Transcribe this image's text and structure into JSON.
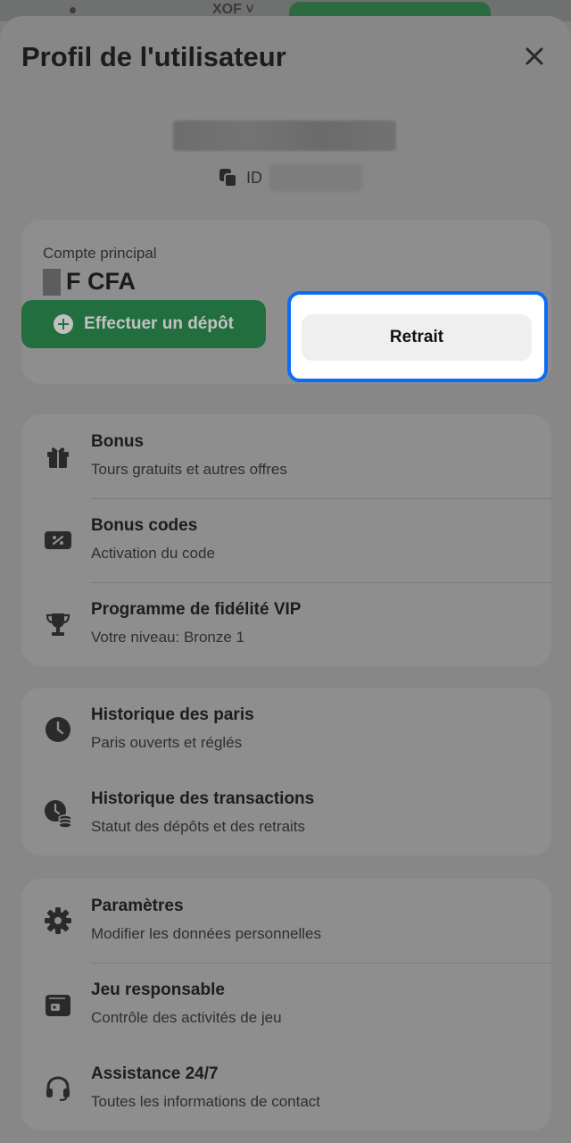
{
  "topbar": {
    "currency": "XOF ˅"
  },
  "header": {
    "title": "Profil de l'utilisateur"
  },
  "user": {
    "id_label": "ID"
  },
  "account": {
    "label": "Compte principal",
    "currency": "F CFA",
    "deposit_label": "Effectuer un dépôt",
    "withdraw_label": "Retrait"
  },
  "groups": [
    {
      "items": [
        {
          "title": "Bonus",
          "subtitle": "Tours gratuits et autres offres",
          "icon": "gift-icon"
        },
        {
          "title": "Bonus codes",
          "subtitle": "Activation du code",
          "icon": "coupon-icon"
        },
        {
          "title": "Programme de fidélité VIP",
          "subtitle": "Votre niveau: Bronze 1",
          "icon": "trophy-icon"
        }
      ]
    },
    {
      "items": [
        {
          "title": "Historique des paris",
          "subtitle": "Paris ouverts et réglés",
          "icon": "clock-icon"
        },
        {
          "title": "Historique des transactions",
          "subtitle": "Statut des dépôts et des retraits",
          "icon": "transaction-history-icon"
        }
      ]
    },
    {
      "items": [
        {
          "title": "Paramètres",
          "subtitle": "Modifier les données personnelles",
          "icon": "gear-icon"
        },
        {
          "title": "Jeu responsable",
          "subtitle": "Contrôle des activités de jeu",
          "icon": "wallet-icon"
        },
        {
          "title": "Assistance 24/7",
          "subtitle": "Toutes les informations de contact",
          "icon": "headset-icon"
        }
      ]
    }
  ],
  "colors": {
    "highlight": "#0b6cf5",
    "deposit": "#236e3e",
    "overlay": "#878788"
  }
}
